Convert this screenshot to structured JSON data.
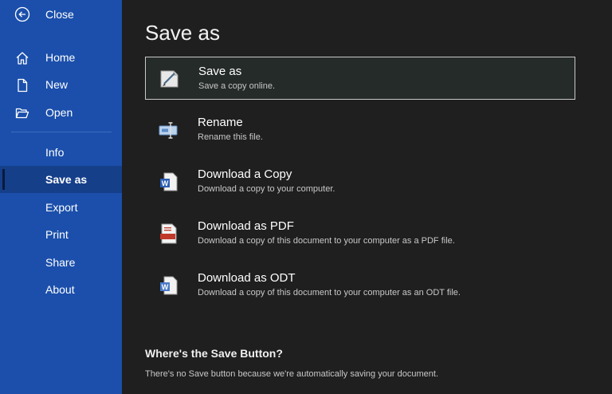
{
  "sidebar": {
    "back_label": "Close",
    "items": [
      {
        "label": "Home",
        "icon": "home-icon"
      },
      {
        "label": "New",
        "icon": "new-document-icon"
      },
      {
        "label": "Open",
        "icon": "folder-open-icon"
      },
      {
        "label": "Info"
      },
      {
        "label": "Save as",
        "selected": true
      },
      {
        "label": "Export"
      },
      {
        "label": "Print"
      },
      {
        "label": "Share"
      },
      {
        "label": "About"
      }
    ],
    "colors": {
      "background": "#1b4fab",
      "selected": "#163f8a"
    }
  },
  "main": {
    "title": "Save as",
    "options": [
      {
        "title": "Save as",
        "description": "Save a copy online.",
        "icon": "save-as-icon",
        "selected": true
      },
      {
        "title": "Rename",
        "description": "Rename this file.",
        "icon": "rename-icon"
      },
      {
        "title": "Download a Copy",
        "description": "Download a copy to your computer.",
        "icon": "word-document-icon"
      },
      {
        "title": "Download as PDF",
        "description": "Download a copy of this document to your computer as a PDF file.",
        "icon": "pdf-icon"
      },
      {
        "title": "Download as ODT",
        "description": "Download a copy of this document to your computer as an ODT file.",
        "icon": "odt-document-icon"
      }
    ],
    "hint": {
      "title": "Where's the Save Button?",
      "text": "There's no Save button because we're automatically saving your document."
    }
  }
}
